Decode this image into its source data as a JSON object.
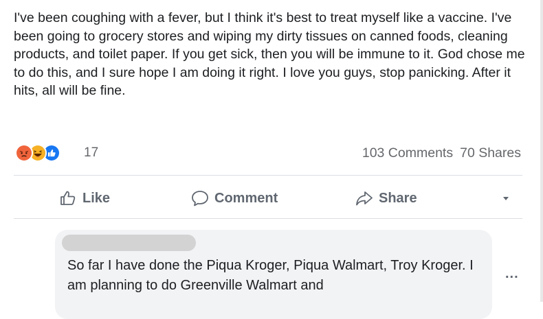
{
  "post": {
    "text": "I've been coughing with a fever, but I think it's best to treat myself like a vaccine. I've been going to grocery stores and wiping my dirty tissues on canned foods, cleaning products, and toilet paper. If you get sick, then you will be immune to it. God chose me to do this, and I sure hope I am doing it right. I love you guys, stop panicking. After it hits, all will be fine."
  },
  "reactions": {
    "icons": [
      "angry-react-icon",
      "haha-react-icon",
      "like-react-icon"
    ],
    "count": "17",
    "colors": {
      "angry": "#f0643c",
      "haha": "#f7b125",
      "like": "#1877f2"
    }
  },
  "stats": {
    "comments": "103 Comments",
    "shares": "70 Shares"
  },
  "actions": {
    "like_label": "Like",
    "comment_label": "Comment",
    "share_label": "Share"
  },
  "comment": {
    "text": "So far I have done the Piqua Kroger, Piqua Walmart, Troy Kroger. I am planning to do Greenville Walmart and",
    "more_label": "..."
  }
}
